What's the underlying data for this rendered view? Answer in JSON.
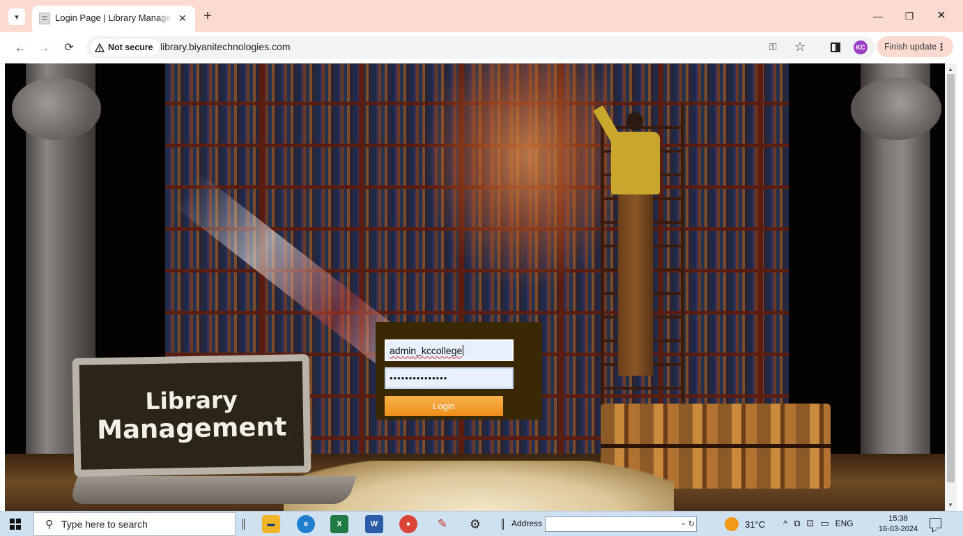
{
  "browser": {
    "tab_title": "Login Page | Library Management",
    "new_tab_symbol": "+",
    "close_symbol": "✕",
    "window_controls": {
      "minimize": "—",
      "maximize": "❐",
      "close": "✕"
    },
    "security_label": "Not secure",
    "url": "library.biyanitechnologies.com",
    "profile_initials": "KC",
    "finish_update_label": "Finish update"
  },
  "page": {
    "laptop_line1": "Library",
    "laptop_line2": "Management",
    "login": {
      "username_value": "admin_kccollege",
      "password_masked": "•••••••••••••••",
      "button_label": "Login"
    }
  },
  "taskbar": {
    "search_placeholder": "Type here to search",
    "address_label": "Address",
    "weather": "31°C",
    "language": "ENG",
    "time": "15:38",
    "date": "16-03-2024",
    "colors": {
      "edge": "#1e7fcf",
      "excel": "#1f7a44",
      "word": "#2b5ca8",
      "chrome": "#db4437",
      "explorer": "#f0b429"
    }
  }
}
